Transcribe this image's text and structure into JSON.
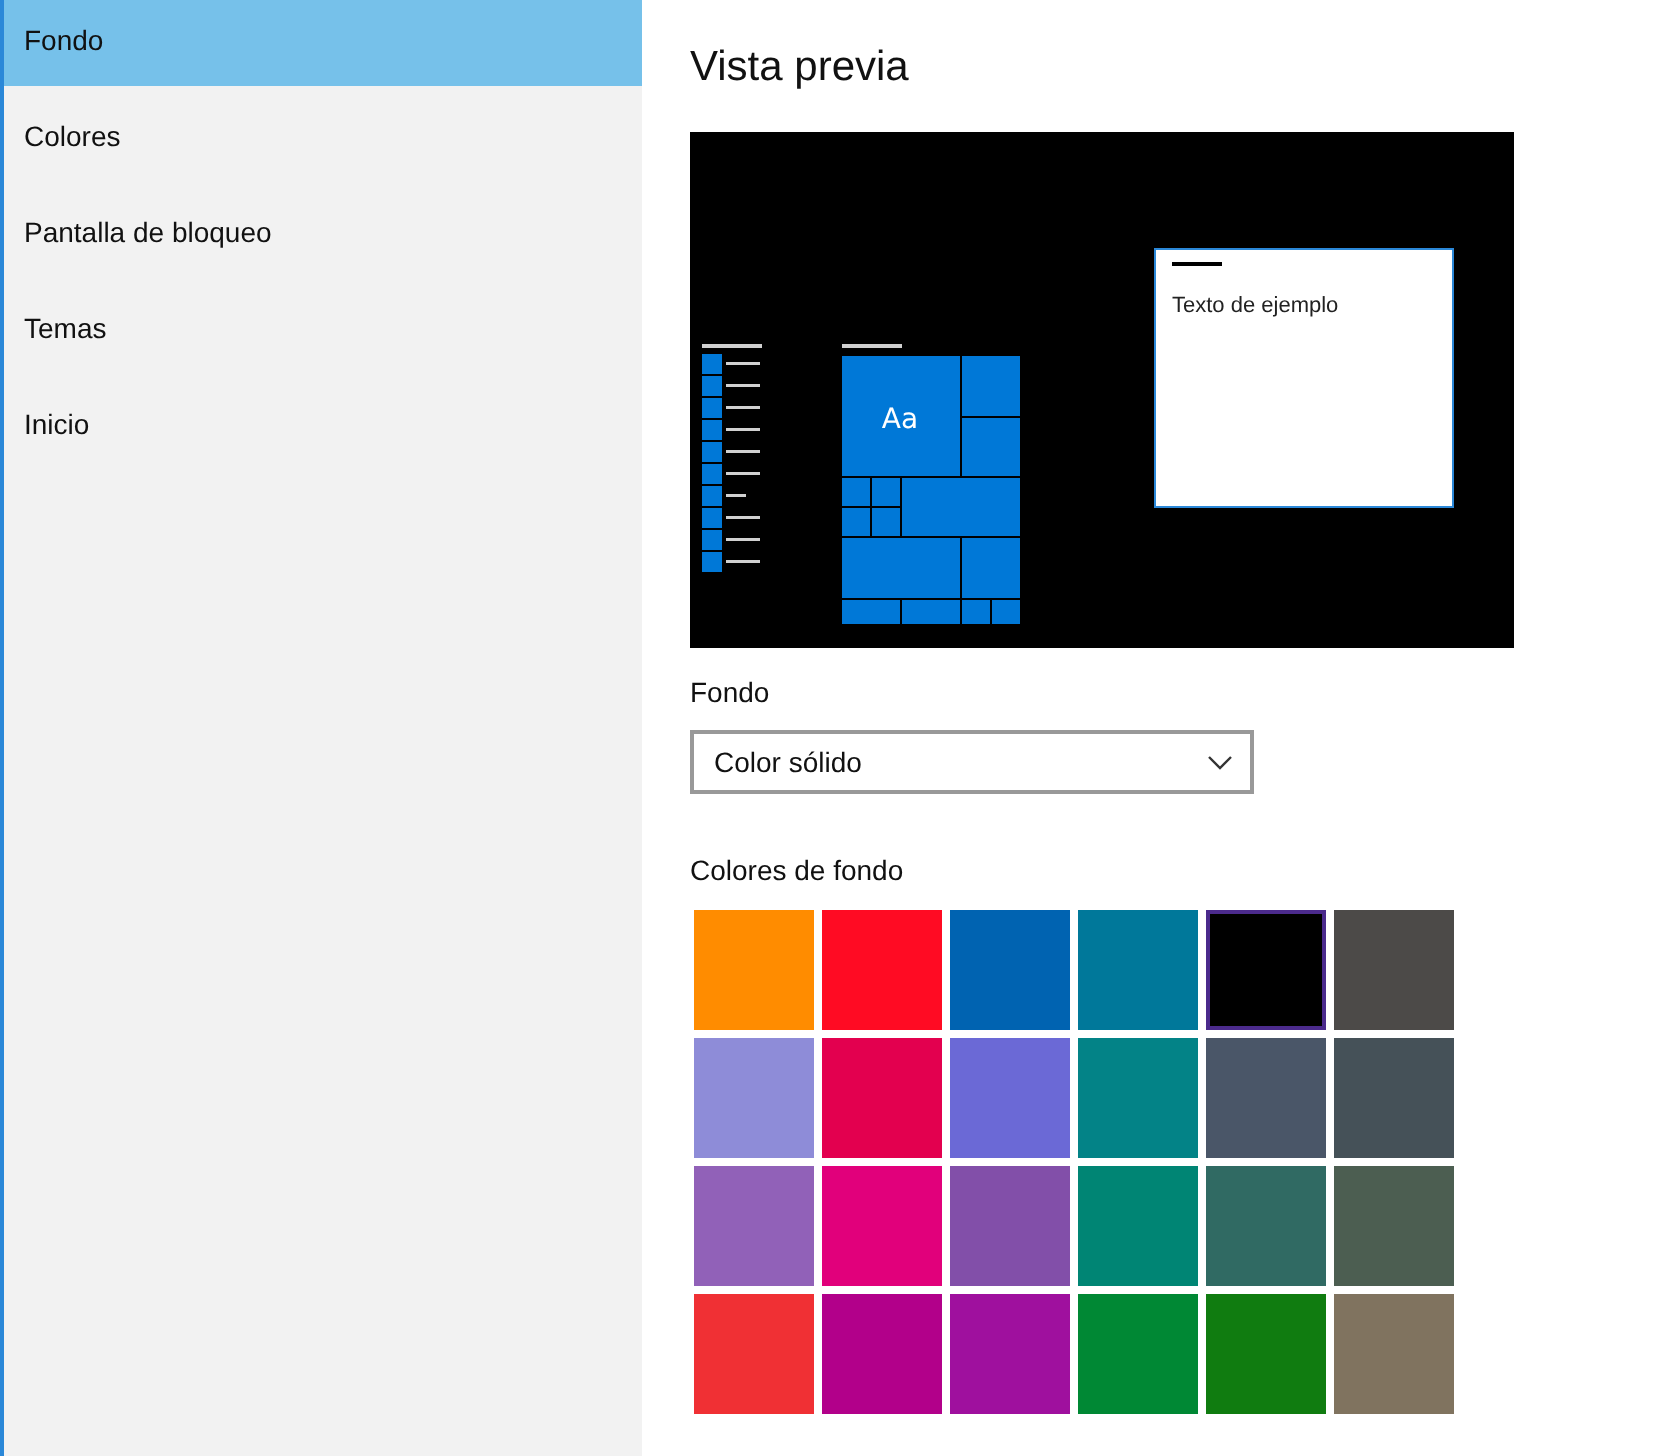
{
  "sidebar": {
    "items": [
      {
        "label": "Fondo",
        "selected": true
      },
      {
        "label": "Colores",
        "selected": false
      },
      {
        "label": "Pantalla de bloqueo",
        "selected": false
      },
      {
        "label": "Temas",
        "selected": false
      },
      {
        "label": "Inicio",
        "selected": false
      }
    ]
  },
  "preview": {
    "title": "Vista previa",
    "tile_text": "Aa",
    "sample_text": "Texto de ejemplo"
  },
  "background": {
    "label": "Fondo",
    "dropdown": {
      "value": "Color sólido"
    }
  },
  "background_colors": {
    "label": "Colores de fondo",
    "swatches": [
      {
        "color": "#ff8c00",
        "selected": false
      },
      {
        "color": "#ff0b23",
        "selected": false
      },
      {
        "color": "#0063b1",
        "selected": false
      },
      {
        "color": "#00789a",
        "selected": false
      },
      {
        "color": "#000000",
        "selected": true
      },
      {
        "color": "#4c4a48",
        "selected": false
      },
      {
        "color": "#8e8cd8",
        "selected": false
      },
      {
        "color": "#e3004f",
        "selected": false
      },
      {
        "color": "#6b69d6",
        "selected": false
      },
      {
        "color": "#038387",
        "selected": false
      },
      {
        "color": "#4a5668",
        "selected": false
      },
      {
        "color": "#455158",
        "selected": false
      },
      {
        "color": "#9161b8",
        "selected": false
      },
      {
        "color": "#e1007b",
        "selected": false
      },
      {
        "color": "#824fa9",
        "selected": false
      },
      {
        "color": "#008574",
        "selected": false
      },
      {
        "color": "#306a63",
        "selected": false
      },
      {
        "color": "#4c5e51",
        "selected": false
      },
      {
        "color": "#f03034",
        "selected": false
      },
      {
        "color": "#b2008a",
        "selected": false
      },
      {
        "color": "#9f109e",
        "selected": false
      },
      {
        "color": "#008834",
        "selected": false
      },
      {
        "color": "#107c10",
        "selected": false
      },
      {
        "color": "#80735f",
        "selected": false
      }
    ]
  }
}
